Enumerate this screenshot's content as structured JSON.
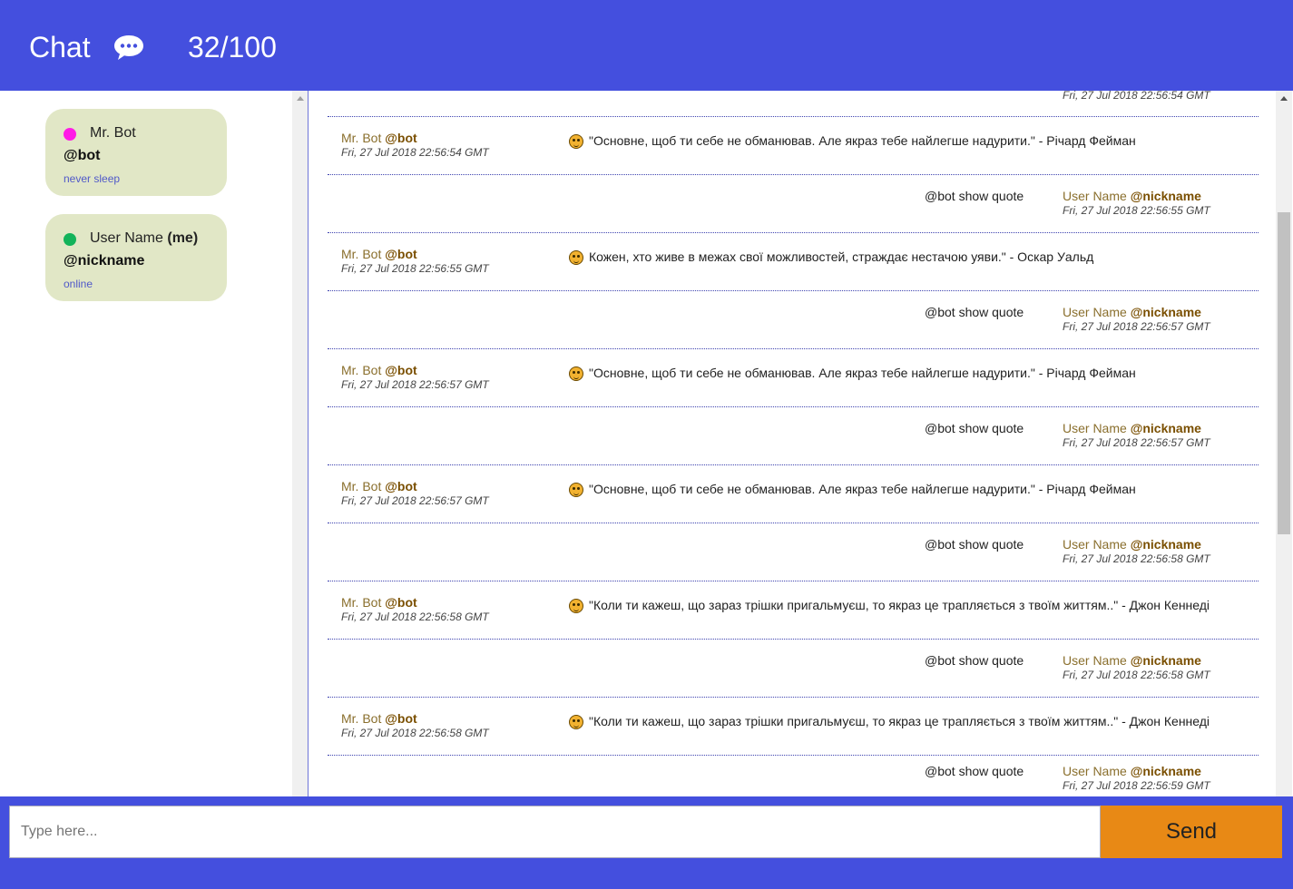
{
  "header": {
    "title": "Chat",
    "counter": "32/100",
    "icon": "speech-bubble-icon",
    "background": "#444fde"
  },
  "sidebar": {
    "users": [
      {
        "name": "Mr. Bot",
        "me": "",
        "nick": "@bot",
        "status": "never sleep",
        "dot_color": "#ff1be6"
      },
      {
        "name": "User Name",
        "me": "(me)",
        "nick": "@nickname",
        "status": "online",
        "dot_color": "#13b35a"
      }
    ]
  },
  "messages": {
    "partial_top_time": "Fri, 27 Jul 2018 22:56:54 GMT",
    "rows": [
      {
        "type": "bot",
        "name": "Mr. Bot",
        "nick": "@bot",
        "time": "Fri, 27 Jul 2018 22:56:54 GMT",
        "text": "\"Основне, щоб ти себе не обманював. Але якраз тебе найлегше надурити.\" - Річард Фейман"
      },
      {
        "type": "user",
        "name": "User Name",
        "nick": "@nickname",
        "time": "Fri, 27 Jul 2018 22:56:55 GMT",
        "text": "@bot show quote"
      },
      {
        "type": "bot",
        "name": "Mr. Bot",
        "nick": "@bot",
        "time": "Fri, 27 Jul 2018 22:56:55 GMT",
        "text": "Кожен, хто живе в межах свої можливостей, страждає нестачою уяви.\" - Оскар Уальд"
      },
      {
        "type": "user",
        "name": "User Name",
        "nick": "@nickname",
        "time": "Fri, 27 Jul 2018 22:56:57 GMT",
        "text": "@bot show quote"
      },
      {
        "type": "bot",
        "name": "Mr. Bot",
        "nick": "@bot",
        "time": "Fri, 27 Jul 2018 22:56:57 GMT",
        "text": "\"Основне, щоб ти себе не обманював. Але якраз тебе найлегше надурити.\" - Річард Фейман"
      },
      {
        "type": "user",
        "name": "User Name",
        "nick": "@nickname",
        "time": "Fri, 27 Jul 2018 22:56:57 GMT",
        "text": "@bot show quote"
      },
      {
        "type": "bot",
        "name": "Mr. Bot",
        "nick": "@bot",
        "time": "Fri, 27 Jul 2018 22:56:57 GMT",
        "text": "\"Основне, щоб ти себе не обманював. Але якраз тебе найлегше надурити.\" - Річард Фейман"
      },
      {
        "type": "user",
        "name": "User Name",
        "nick": "@nickname",
        "time": "Fri, 27 Jul 2018 22:56:58 GMT",
        "text": "@bot show quote"
      },
      {
        "type": "bot",
        "name": "Mr. Bot",
        "nick": "@bot",
        "time": "Fri, 27 Jul 2018 22:56:58 GMT",
        "text": "\"Коли ти кажеш, що зараз трішки пригальмуєш, то якраз це трапляється з твоїм життям..\" - Джон Кеннеді"
      },
      {
        "type": "user",
        "name": "User Name",
        "nick": "@nickname",
        "time": "Fri, 27 Jul 2018 22:56:58 GMT",
        "text": "@bot show quote"
      },
      {
        "type": "bot",
        "name": "Mr. Bot",
        "nick": "@bot",
        "time": "Fri, 27 Jul 2018 22:56:58 GMT",
        "text": "\"Коли ти кажеш, що зараз трішки пригальмуєш, то якраз це трапляється з твоїм життям..\" - Джон Кеннеді"
      },
      {
        "type": "user",
        "name": "User Name",
        "nick": "@nickname",
        "time": "Fri, 27 Jul 2018 22:56:59 GMT",
        "text": "@bot show quote"
      }
    ]
  },
  "composer": {
    "placeholder": "Type here...",
    "send_label": "Send",
    "send_color": "#e88915"
  }
}
